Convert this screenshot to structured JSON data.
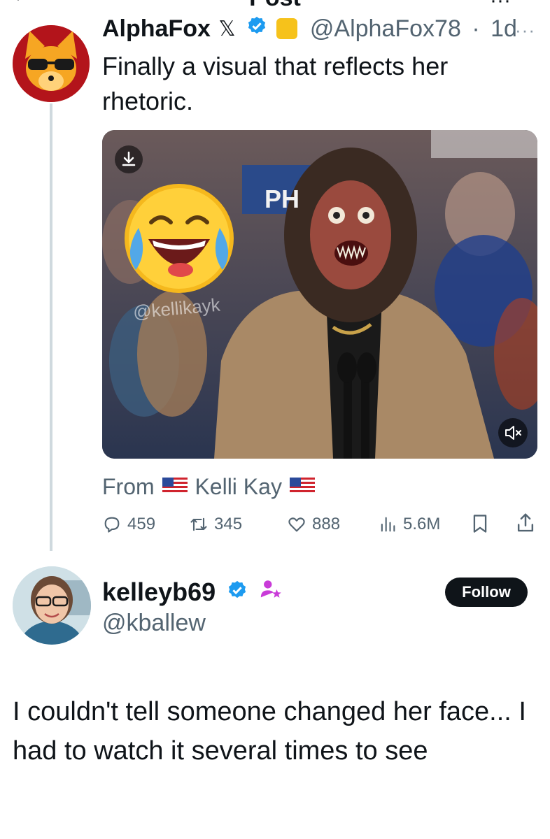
{
  "header": {
    "title": "Post"
  },
  "parent_tweet": {
    "author_name": "AlphaFox",
    "x_logo": "𝕏",
    "handle": "@AlphaFox78",
    "separator": "·",
    "age": "1d",
    "more": "···",
    "text": "Finally a visual that reflects her rhetoric.",
    "media": {
      "sign_text": "PH",
      "watermark": "@kellikayk",
      "download_icon": "download-icon",
      "mute_icon": "mute-icon"
    },
    "from_prefix": "From",
    "from_name": "Kelli Kay",
    "stats": {
      "replies": "459",
      "reposts": "345",
      "likes": "888",
      "views": "5.6M"
    }
  },
  "reply": {
    "display_name": "kelleyb69",
    "handle": "@kballew",
    "follow_label": "Follow",
    "text": "I couldn't tell someone changed her face... I had to watch it several times to see"
  },
  "colors": {
    "verified_blue": "#1d9bf0",
    "gold_badge": "#f6c21b",
    "secondary_text": "#536471",
    "subscriber_purple": "#c93bd8"
  }
}
